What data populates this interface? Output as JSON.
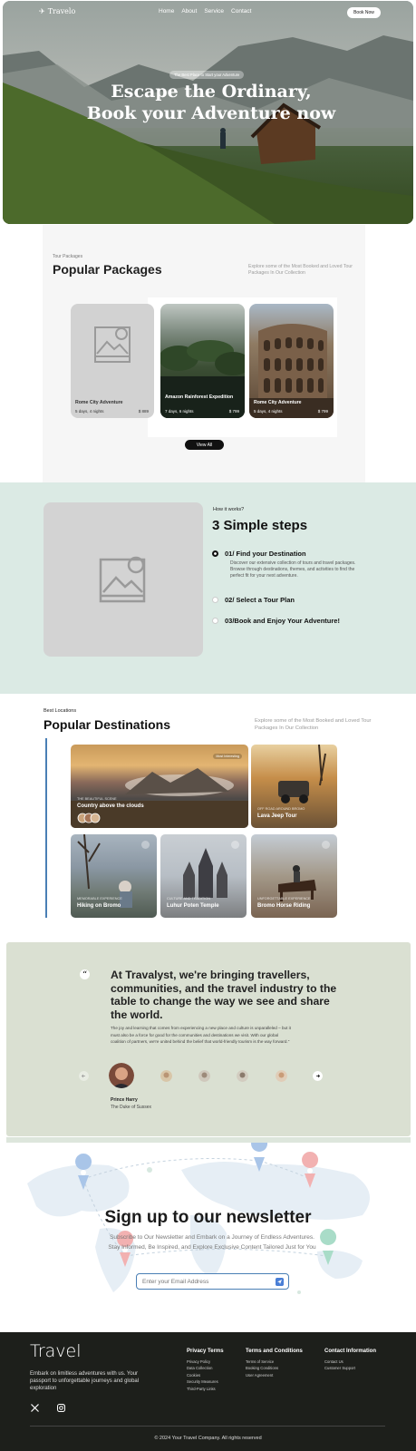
{
  "nav": {
    "brand": "Travelo",
    "links": [
      "Home",
      "About",
      "Service",
      "Contact"
    ],
    "cta": "Book Now"
  },
  "hero": {
    "pill": "The Best Place to Start your Adventure",
    "title_line1": "Escape the Ordinary,",
    "title_line2": "Book your Adventure now"
  },
  "packages": {
    "eyebrow": "Tour Packages",
    "title": "Popular Packages",
    "description": "Explore some of the Most Booked and Loved Tour Packages In Our Collection",
    "cards": [
      {
        "title": "Rome City Adventure",
        "duration": "5 days, 4 nights",
        "price": "$ 889"
      },
      {
        "title": "Amazon Rainforest Expedition",
        "duration": "7 days, 6 nights",
        "price": "$ 799"
      },
      {
        "title": "Rome City Adventure",
        "duration": "5 days, 4 nights",
        "price": "$ 799"
      }
    ],
    "view_all": "View All"
  },
  "steps": {
    "eyebrow": "How it works?",
    "title": "3 Simple steps",
    "items": [
      {
        "label": "01/ Find your Destination",
        "description": "Discover our extensive collection of tours and travel packages. Browse through destinations, themes, and activities to find the perfect fit for your next adventure.",
        "selected": true
      },
      {
        "label": "02/ Select a Tour Plan",
        "selected": false
      },
      {
        "label": "03/Book and Enjoy Your Adventure!",
        "selected": false
      }
    ]
  },
  "destinations": {
    "eyebrow": "Best Locations",
    "title": "Popular Destinations",
    "description": "Explore some of the Most Booked and Loved Tour Packages In Our Collection",
    "cards": [
      {
        "subtitle": "THE BEAUTIFUL SCENE",
        "name": "Country above the clouds",
        "badge": "Most Interesting"
      },
      {
        "subtitle": "OFF ROAD AROUND BROMO",
        "name": "Lava Jeep Tour"
      },
      {
        "subtitle": "MEMORABLE EXPERIENCE",
        "name": "Hiking on Bromo"
      },
      {
        "subtitle": "CULTURE AND TRADITION",
        "name": "Luhur Poten Temple"
      },
      {
        "subtitle": "UNFORGETTABLE EXPERIENCE",
        "name": "Bromo Horse Riding"
      }
    ]
  },
  "testimonial": {
    "quote_mark": "“",
    "headline": "At Travalyst, we're bringing travellers, communities, and the travel industry to the table to change the way we see and share the world.",
    "body": "The joy and learning that comes from experiencing a new place and culture is unparalleled – but it must also be a force for good for the communities and destinations we visit. With our global coalition of partners, we're united behind the belief that world-friendly tourism is the way forward.\"",
    "person_name": "Prince Harry",
    "person_role": "The Duke of Sussex"
  },
  "newsletter": {
    "title": "Sign up to our newsletter",
    "description": "Subscribe to Our Newsletter and Embark on a Journey of Endless Adventures. Stay Informed, Be Inspired, and Explore Exclusive Content Tailored Just for You",
    "placeholder": "Enter your Email Address"
  },
  "footer": {
    "brand": "Travel",
    "tagline": "Embark on limitless adventures with us. Your passport to unforgettable journeys and global exploration",
    "columns": [
      {
        "title": "Privacy Terms",
        "links": [
          "Privacy Policy",
          "Data Collection",
          "Cookies",
          "Security Measures",
          "Third-Party Links"
        ]
      },
      {
        "title": "Terms and Conditions",
        "links": [
          "Terms of Service",
          "Booking Conditions",
          "User Agreement"
        ]
      },
      {
        "title": "Contact Information",
        "links": [
          "Contact Us",
          "Customer Support"
        ]
      }
    ],
    "copyright": "© 2024 Your Travel Company. All rights reserved"
  },
  "colors": {
    "accent": "#4a7fb5",
    "steps_bg": "#dbeae4",
    "quote_bg": "#dae0d2",
    "footer_bg": "#1d1f1b"
  },
  "icons": {
    "brand": "plane-icon",
    "social": [
      "x-icon",
      "instagram-icon"
    ],
    "send": "send-icon"
  }
}
